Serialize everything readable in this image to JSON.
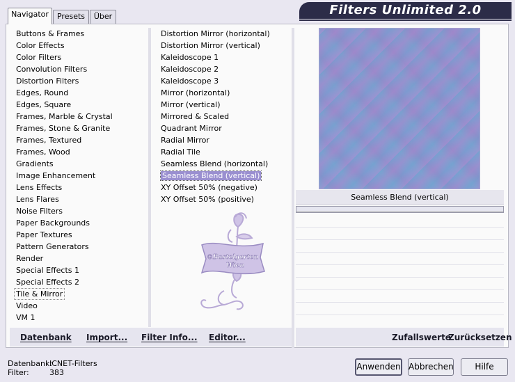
{
  "window": {
    "title": "Filters Unlimited 2.0"
  },
  "tabs": [
    "Navigator",
    "Presets",
    "Über"
  ],
  "categories": [
    "Buttons & Frames",
    "Color Effects",
    "Color Filters",
    "Convolution Filters",
    "Distortion Filters",
    "Edges, Round",
    "Edges, Square",
    "Frames, Marble & Crystal",
    "Frames, Stone & Granite",
    "Frames, Textured",
    "Frames, Wood",
    "Gradients",
    "Image Enhancement",
    "Lens Effects",
    "Lens Flares",
    "Noise Filters",
    "Paper Backgrounds",
    "Paper Textures",
    "Pattern Generators",
    "Render",
    "Special Effects 1",
    "Special Effects 2",
    "Tile & Mirror",
    "Video",
    "VM 1"
  ],
  "selected_category": "Tile & Mirror",
  "filters": [
    "Distortion Mirror (horizontal)",
    "Distortion Mirror (vertical)",
    "Kaleidoscope 1",
    "Kaleidoscope 2",
    "Kaleidoscope 3",
    "Mirror (horizontal)",
    "Mirror (vertical)",
    "Mirrored & Scaled",
    "Quadrant Mirror",
    "Radial Mirror",
    "Radial Tile",
    "Seamless Blend (horizontal)",
    "Seamless Blend (vertical)",
    "XY Offset 50% (negative)",
    "XY Offset 50% (positive)"
  ],
  "selected_filter": "Seamless Blend (vertical)",
  "preview": {
    "filter_name": "Seamless Blend (vertical)"
  },
  "watermark": {
    "line1": "©Bastelgarten",
    "line2": "Wien"
  },
  "toolbar": {
    "database": "Datenbank",
    "import": "Import...",
    "filter_info": "Filter Info...",
    "editor": "Editor...",
    "random": "Zufallswerte",
    "reset": "Zurücksetzen"
  },
  "status": {
    "db_label": "Datenbank:",
    "db_value": "ICNET-Filters",
    "filter_label": "Filter:",
    "filter_value": "383"
  },
  "buttons": {
    "apply": "Anwenden",
    "cancel": "Abbrechen",
    "help": "Hilfe"
  },
  "colors": {
    "banner": "#2c2c48",
    "selection": "#9a8fd0",
    "background": "#e9e7f1"
  }
}
